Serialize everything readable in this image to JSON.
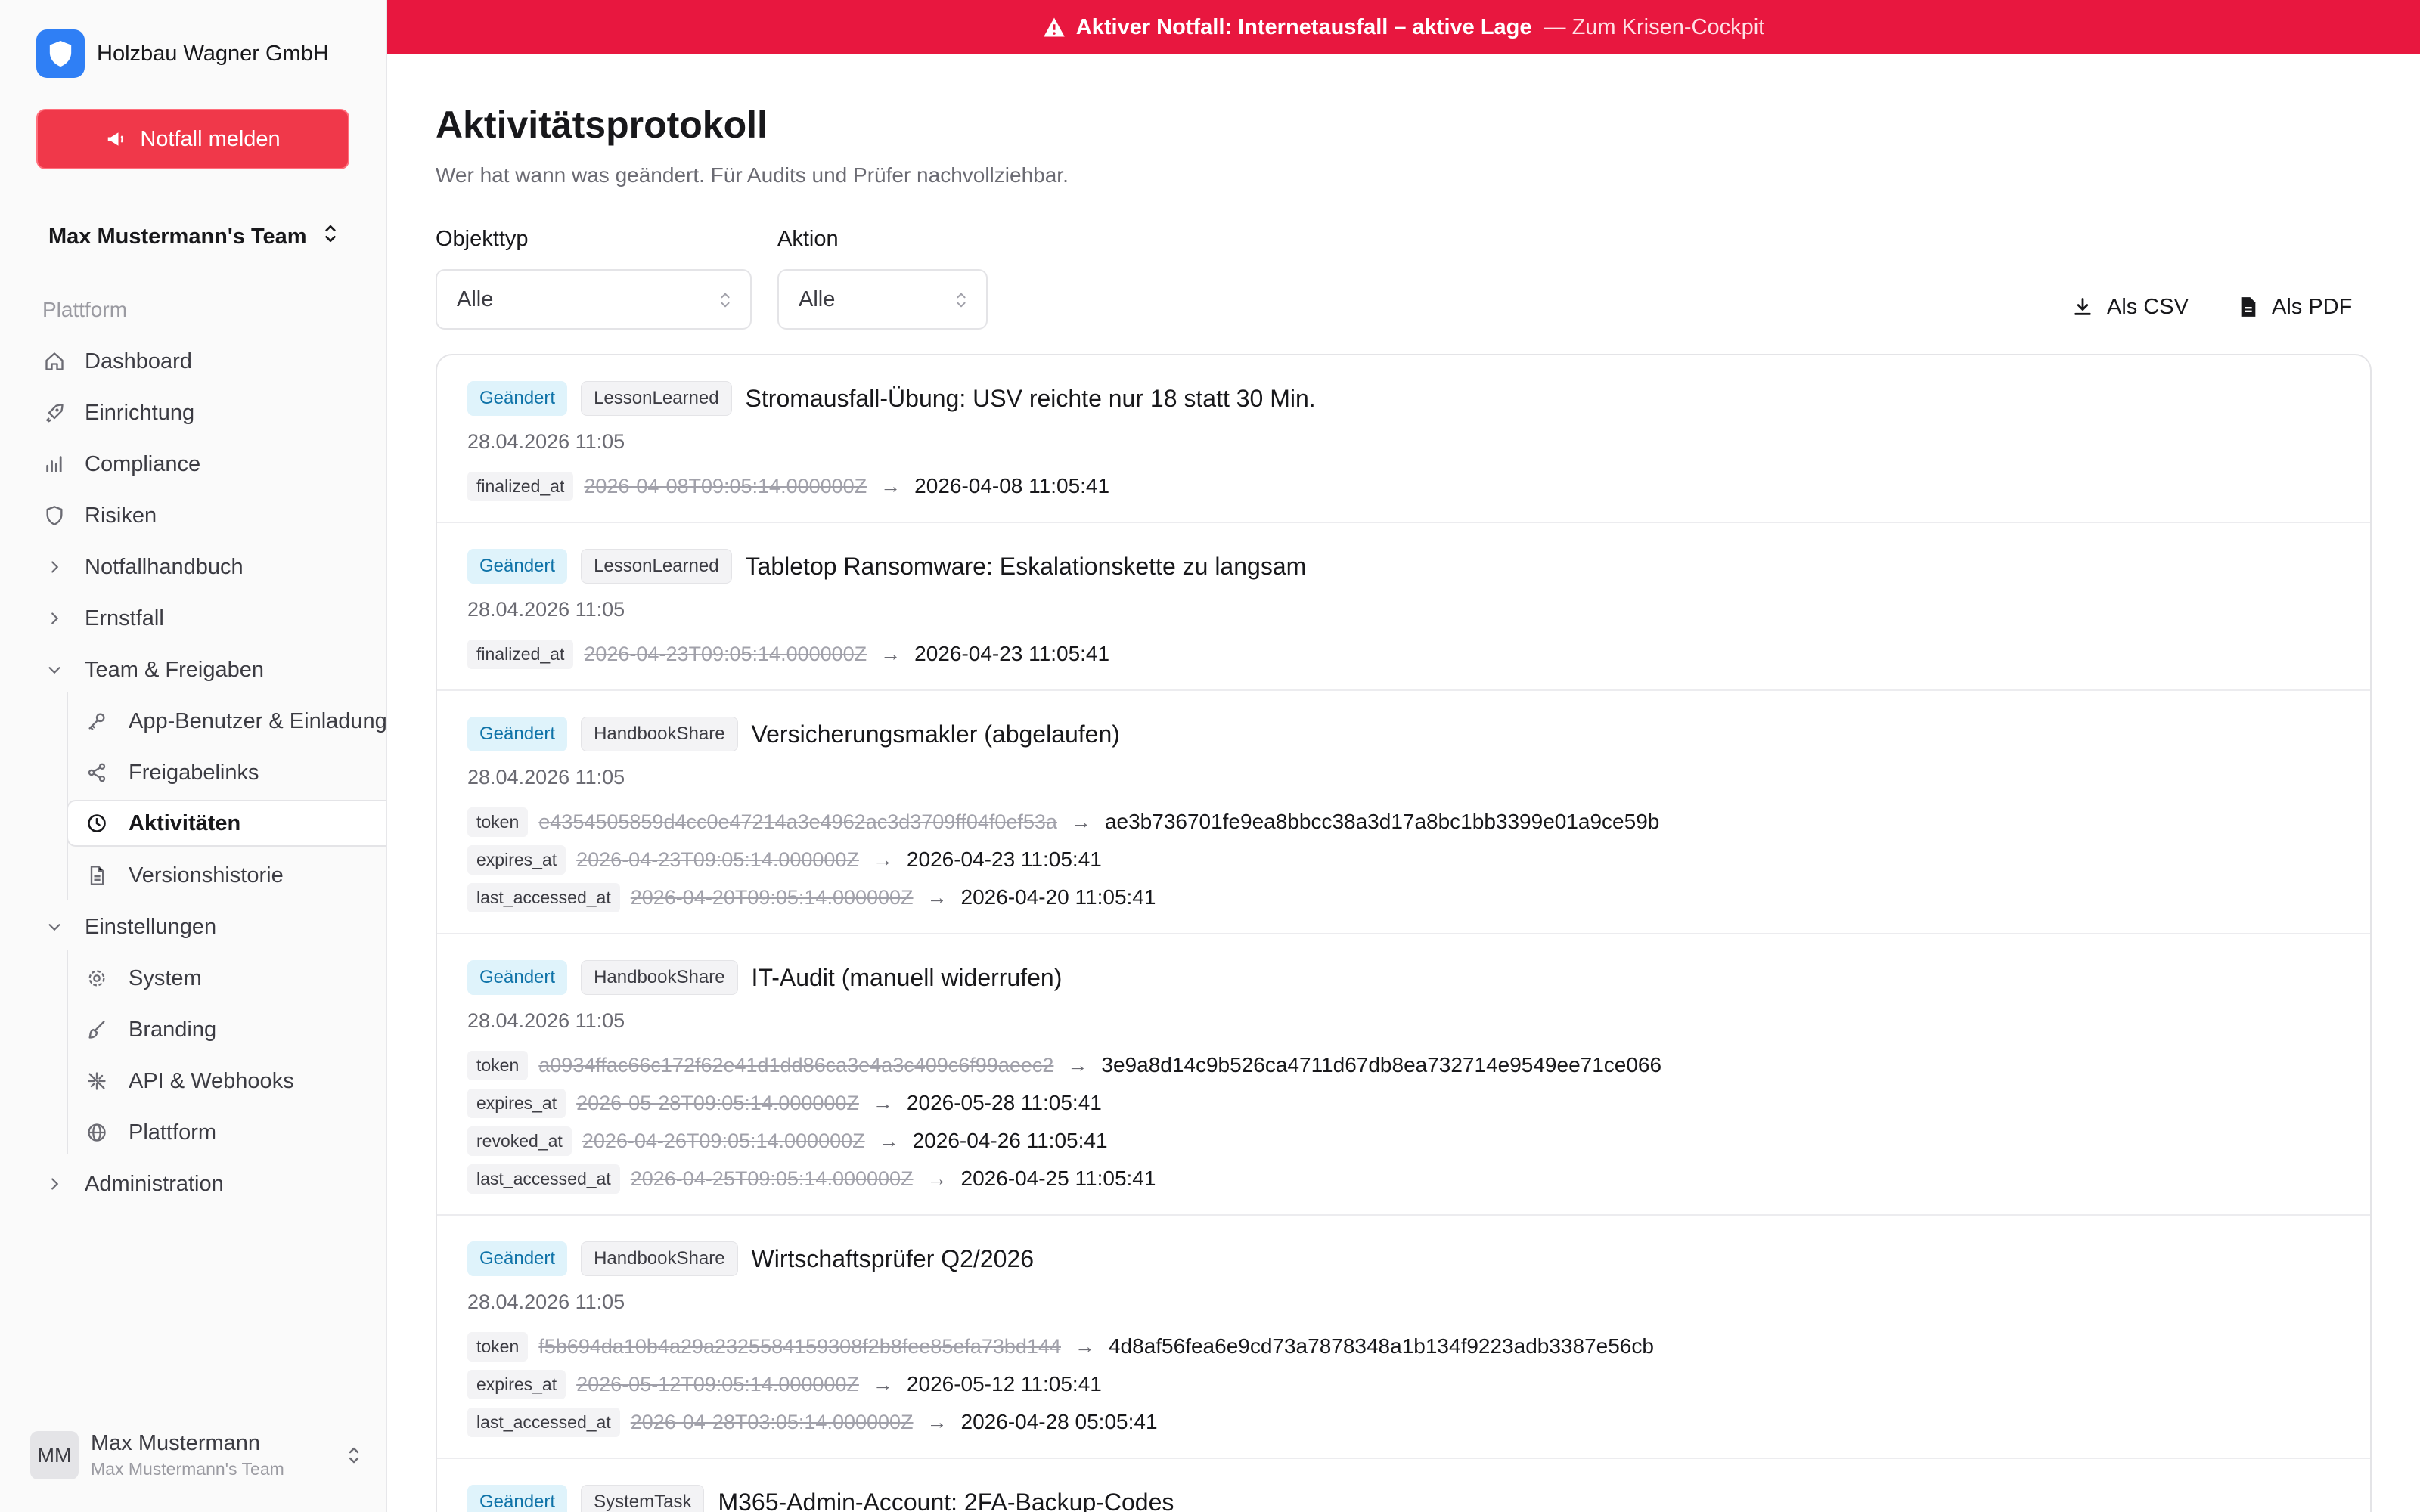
{
  "org": {
    "name": "Holzbau Wagner GmbH"
  },
  "emergency_button": {
    "label": "Notfall melden"
  },
  "team_switch": {
    "label": "Max Mustermann's Team"
  },
  "nav": {
    "group_label": "Plattform",
    "items": [
      {
        "label": "Dashboard",
        "icon": "home-icon"
      },
      {
        "label": "Einrichtung",
        "icon": "rocket-icon"
      },
      {
        "label": "Compliance",
        "icon": "bar-chart-icon"
      },
      {
        "label": "Risiken",
        "icon": "shield-icon"
      },
      {
        "label": "Notfallhandbuch",
        "icon": "chevron-right-icon"
      },
      {
        "label": "Ernstfall",
        "icon": "chevron-right-icon"
      },
      {
        "label": "Team & Freigaben",
        "icon": "chevron-down-icon"
      },
      {
        "label": "App-Benutzer & Einladungen",
        "icon": "key-icon"
      },
      {
        "label": "Freigabelinks",
        "icon": "share-icon"
      },
      {
        "label": "Aktivitäten",
        "icon": "clock-icon"
      },
      {
        "label": "Versionshistorie",
        "icon": "file-icon"
      },
      {
        "label": "Einstellungen",
        "icon": "chevron-down-icon"
      },
      {
        "label": "System",
        "icon": "gear-icon"
      },
      {
        "label": "Branding",
        "icon": "brush-icon"
      },
      {
        "label": "API & Webhooks",
        "icon": "webhook-icon"
      },
      {
        "label": "Plattform",
        "icon": "globe-icon"
      },
      {
        "label": "Administration",
        "icon": "chevron-right-icon"
      }
    ]
  },
  "user": {
    "initials": "MM",
    "name": "Max Mustermann",
    "team": "Max Mustermann's Team"
  },
  "banner": {
    "message": "Aktiver Notfall: Internetausfall – aktive Lage",
    "link": "— Zum Krisen-Cockpit"
  },
  "page": {
    "title": "Aktivitätsprotokoll",
    "subtitle": "Wer hat wann was geändert. Für Audits und Prüfer nachvollziehbar."
  },
  "filters": {
    "object_type": {
      "label": "Objekttyp",
      "value": "Alle"
    },
    "action": {
      "label": "Aktion",
      "value": "Alle"
    }
  },
  "export": {
    "csv": "Als CSV",
    "pdf": "Als PDF"
  },
  "entries": [
    {
      "action": "Geändert",
      "type": "LessonLearned",
      "title": "Stromausfall-Übung: USV reichte nur 18 statt 30 Min.",
      "time": "28.04.2026 11:05",
      "changes": [
        {
          "field": "finalized_at",
          "old": "2026-04-08T09:05:14.000000Z",
          "new": "2026-04-08 11:05:41"
        }
      ]
    },
    {
      "action": "Geändert",
      "type": "LessonLearned",
      "title": "Tabletop Ransomware: Eskalationskette zu langsam",
      "time": "28.04.2026 11:05",
      "changes": [
        {
          "field": "finalized_at",
          "old": "2026-04-23T09:05:14.000000Z",
          "new": "2026-04-23 11:05:41"
        }
      ]
    },
    {
      "action": "Geändert",
      "type": "HandbookShare",
      "title": "Versicherungsmakler (abgelaufen)",
      "time": "28.04.2026 11:05",
      "changes": [
        {
          "field": "token",
          "old": "e4354505859d4cc0e47214a3e4962ac3d3709ff04f0ef53a",
          "new": "ae3b736701fe9ea8bbcc38a3d17a8bc1bb3399e01a9ce59b"
        },
        {
          "field": "expires_at",
          "old": "2026-04-23T09:05:14.000000Z",
          "new": "2026-04-23 11:05:41"
        },
        {
          "field": "last_accessed_at",
          "old": "2026-04-20T09:05:14.000000Z",
          "new": "2026-04-20 11:05:41"
        }
      ]
    },
    {
      "action": "Geändert",
      "type": "HandbookShare",
      "title": "IT-Audit (manuell widerrufen)",
      "time": "28.04.2026 11:05",
      "changes": [
        {
          "field": "token",
          "old": "a0934ffac66c172f62e41d1dd86ca3e4a3c409c6f99aeec2",
          "new": "3e9a8d14c9b526ca4711d67db8ea732714e9549ee71ce066"
        },
        {
          "field": "expires_at",
          "old": "2026-05-28T09:05:14.000000Z",
          "new": "2026-05-28 11:05:41"
        },
        {
          "field": "revoked_at",
          "old": "2026-04-26T09:05:14.000000Z",
          "new": "2026-04-26 11:05:41"
        },
        {
          "field": "last_accessed_at",
          "old": "2026-04-25T09:05:14.000000Z",
          "new": "2026-04-25 11:05:41"
        }
      ]
    },
    {
      "action": "Geändert",
      "type": "HandbookShare",
      "title": "Wirtschaftsprüfer Q2/2026",
      "time": "28.04.2026 11:05",
      "changes": [
        {
          "field": "token",
          "old": "f5b694da10b4a29a2325584159308f2b8fee85efa73bd144",
          "new": "4d8af56fea6e9cd73a7878348a1b134f9223adb3387e56cb"
        },
        {
          "field": "expires_at",
          "old": "2026-05-12T09:05:14.000000Z",
          "new": "2026-05-12 11:05:41"
        },
        {
          "field": "last_accessed_at",
          "old": "2026-04-28T03:05:14.000000Z",
          "new": "2026-04-28 05:05:41"
        }
      ]
    },
    {
      "action": "Geändert",
      "type": "SystemTask",
      "title": "M365-Admin-Account: 2FA-Backup-Codes",
      "time": "",
      "changes": []
    }
  ]
}
